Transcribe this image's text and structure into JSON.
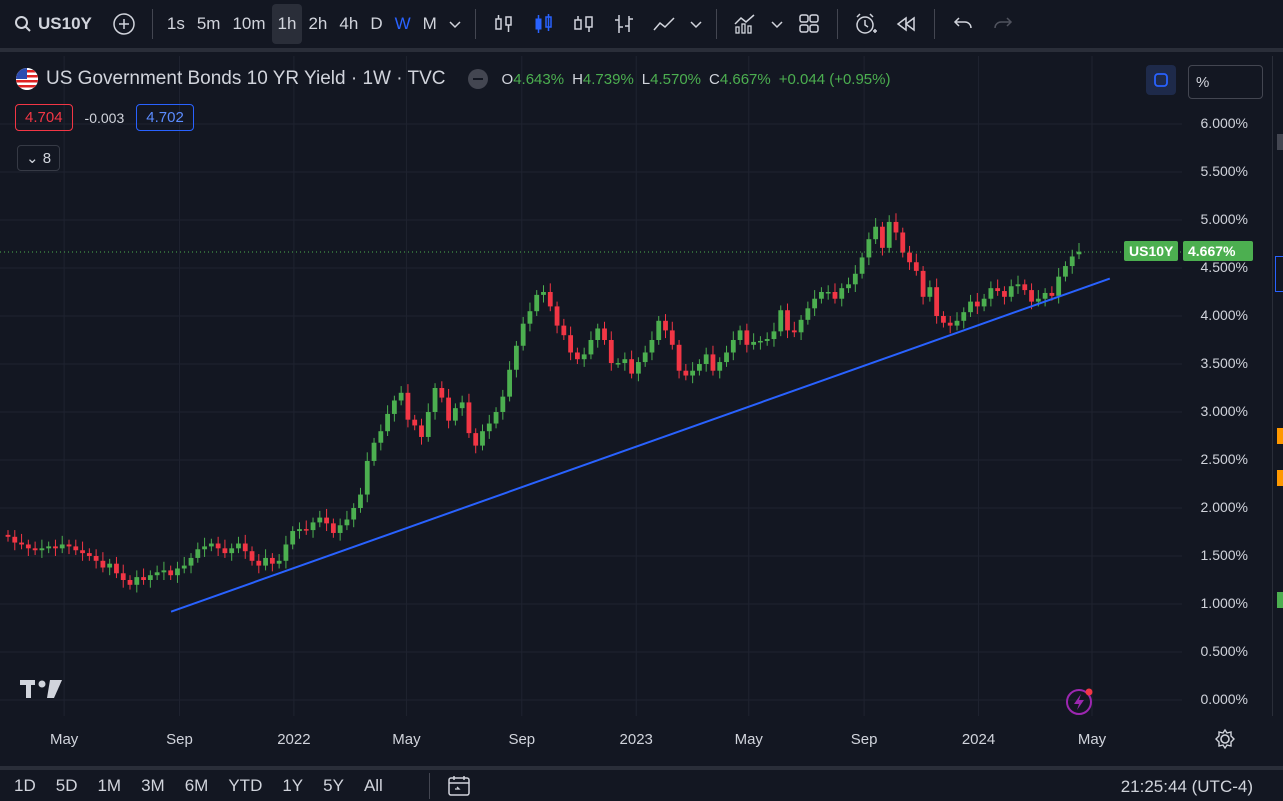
{
  "toolbar": {
    "symbol": "US10Y",
    "intervals": [
      "1s",
      "5m",
      "10m",
      "1h",
      "2h",
      "4h",
      "D",
      "W",
      "M"
    ],
    "active_interval": "1h",
    "highlight_interval": "W"
  },
  "legend": {
    "title": "US Government Bonds 10 YR Yield · 1W · TVC",
    "open_key": "O",
    "open": "4.643%",
    "high_key": "H",
    "high": "4.739%",
    "low_key": "L",
    "low": "4.570%",
    "close_key": "C",
    "close": "4.667%",
    "change": "+0.044 (+0.95%)"
  },
  "quotes": {
    "bid": "4.704",
    "spread": "-0.003",
    "ask": "4.702"
  },
  "indicators_toggle": "8",
  "scale_mode": "%",
  "price_tag": {
    "symbol": "US10Y",
    "price": "4.667%"
  },
  "price_axis": {
    "ticks": [
      "6.000%",
      "5.500%",
      "5.000%",
      "4.500%",
      "4.000%",
      "3.500%",
      "3.000%",
      "2.500%",
      "2.000%",
      "1.500%",
      "1.000%",
      "0.500%",
      "0.000%"
    ]
  },
  "time_axis": {
    "labels": [
      "May",
      "Sep",
      "2022",
      "May",
      "Sep",
      "2023",
      "May",
      "Sep",
      "2024",
      "May"
    ]
  },
  "ranges": [
    "1D",
    "5D",
    "1M",
    "3M",
    "6M",
    "YTD",
    "1Y",
    "5Y",
    "All"
  ],
  "clock": "21:25:44 (UTC-4)",
  "colors": {
    "up": "#4caf50",
    "down": "#f23645",
    "trend": "#2962ff",
    "bg": "#131722"
  },
  "chart_data": {
    "type": "candlestick",
    "interval": "weekly",
    "y_unit": "%",
    "ylim": [
      0,
      6
    ],
    "trendline": [
      {
        "date": "2021-08-23",
        "value": 0.92
      },
      {
        "date": "2024-05-20",
        "value": 4.39
      }
    ],
    "closes": [
      1.7,
      1.64,
      1.62,
      1.58,
      1.56,
      1.58,
      1.6,
      1.58,
      1.62,
      1.6,
      1.56,
      1.53,
      1.5,
      1.45,
      1.38,
      1.42,
      1.32,
      1.25,
      1.2,
      1.28,
      1.25,
      1.3,
      1.33,
      1.35,
      1.3,
      1.37,
      1.4,
      1.48,
      1.57,
      1.6,
      1.63,
      1.58,
      1.53,
      1.58,
      1.63,
      1.55,
      1.45,
      1.4,
      1.48,
      1.42,
      1.45,
      1.62,
      1.76,
      1.78,
      1.77,
      1.85,
      1.9,
      1.84,
      1.74,
      1.82,
      1.88,
      2.0,
      2.14,
      2.49,
      2.68,
      2.8,
      2.98,
      3.12,
      3.2,
      2.92,
      2.86,
      2.74,
      3.0,
      3.25,
      3.15,
      2.91,
      3.04,
      3.1,
      2.78,
      2.65,
      2.8,
      2.88,
      3.0,
      3.16,
      3.44,
      3.69,
      3.92,
      4.05,
      4.22,
      4.25,
      4.1,
      3.9,
      3.8,
      3.62,
      3.55,
      3.6,
      3.75,
      3.87,
      3.75,
      3.51,
      3.51,
      3.55,
      3.4,
      3.52,
      3.62,
      3.75,
      3.95,
      3.85,
      3.7,
      3.43,
      3.38,
      3.43,
      3.5,
      3.6,
      3.43,
      3.52,
      3.62,
      3.75,
      3.85,
      3.7,
      3.73,
      3.74,
      3.76,
      3.84,
      4.06,
      3.85,
      3.83,
      3.96,
      4.08,
      4.18,
      4.25,
      4.25,
      4.18,
      4.29,
      4.33,
      4.44,
      4.61,
      4.8,
      4.93,
      4.71,
      4.98,
      4.87,
      4.66,
      4.56,
      4.47,
      4.2,
      4.3,
      4.0,
      3.93,
      3.9,
      3.95,
      4.04,
      4.15,
      4.1,
      4.18,
      4.29,
      4.26,
      4.2,
      4.31,
      4.33,
      4.27,
      4.15,
      4.18,
      4.24,
      4.21,
      4.41,
      4.52,
      4.62,
      4.67
    ]
  }
}
